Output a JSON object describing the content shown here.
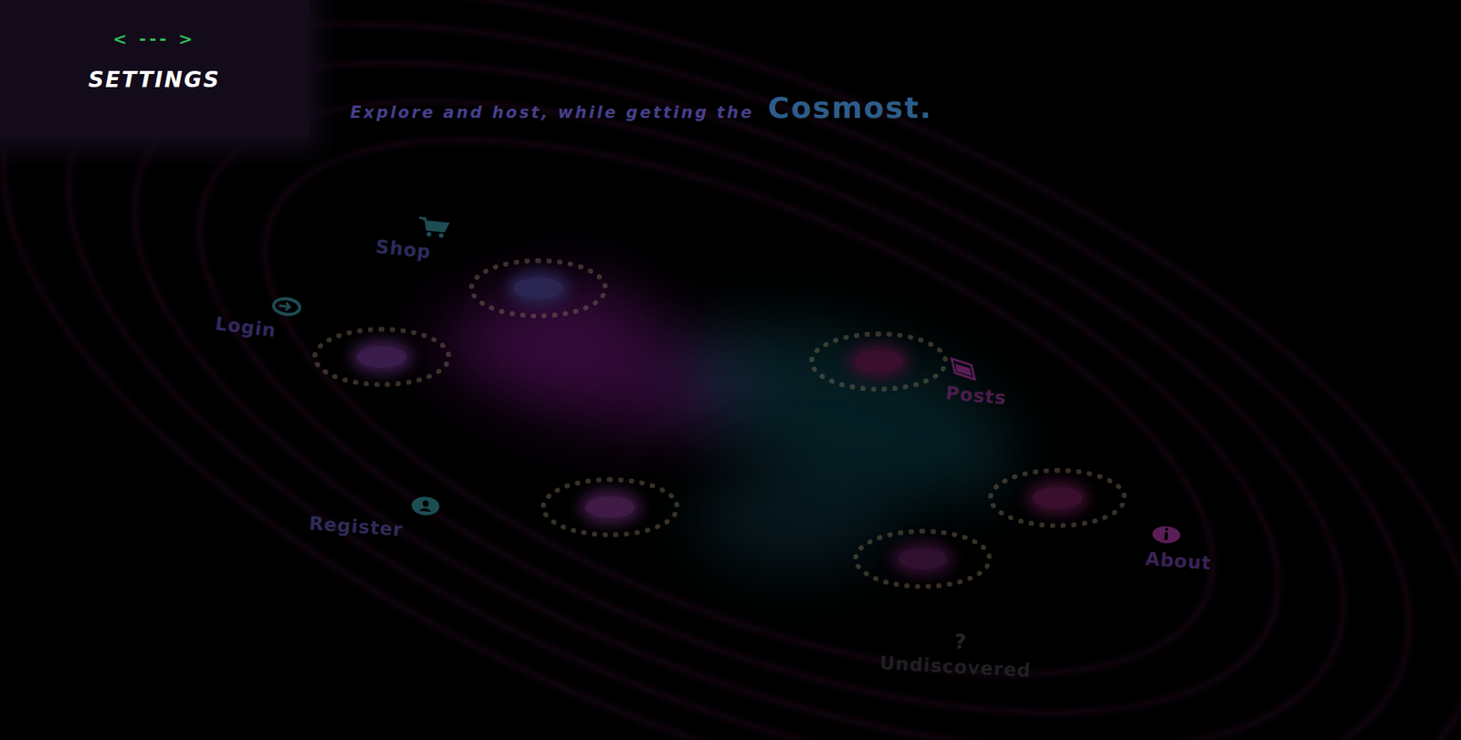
{
  "header": {
    "nav": "< --- >",
    "title": "SETTINGS"
  },
  "tagline": {
    "text": "Explore and host, while getting the",
    "brand": "Cosmost."
  },
  "nodes": [
    {
      "label": "Shop",
      "kind": "shop",
      "color": "#1d4d52"
    },
    {
      "label": "Login",
      "kind": "login",
      "color": "#1d4d52"
    },
    {
      "label": "Register",
      "kind": "register",
      "color": "#1d4d52"
    },
    {
      "label": "Posts",
      "kind": "posts",
      "color": "#5a1d55"
    },
    {
      "label": "About",
      "kind": "about",
      "color": "#5a1d55"
    },
    {
      "label": "Undiscovered",
      "kind": "undiscovered",
      "color": "#262626",
      "glyph": "?"
    }
  ]
}
